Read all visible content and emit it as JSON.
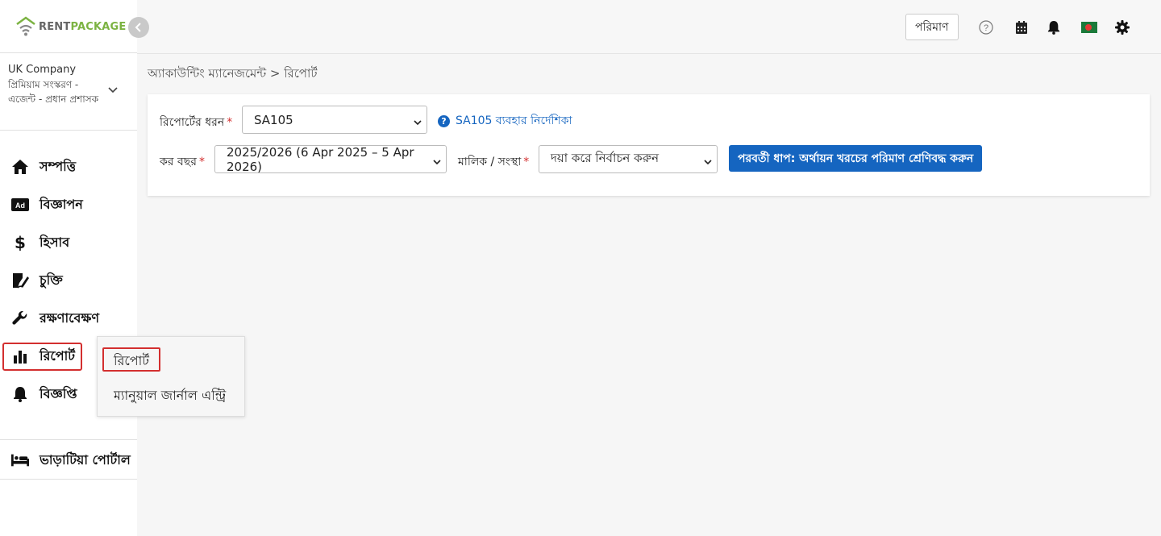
{
  "brand": {
    "rent": "RENT",
    "package": "PACKAGE",
    "accent": "#7cb342"
  },
  "company": {
    "name": "UK Company",
    "details": "প্রিমিয়াম সংস্করণ - এজেন্ট - প্রধান প্রশাসক"
  },
  "sidebar": {
    "items": [
      {
        "label": "সম্পত্তি",
        "icon": "home-icon"
      },
      {
        "label": "বিজ্ঞাপন",
        "icon": "ad-icon"
      },
      {
        "label": "হিসাব",
        "icon": "dollar-icon"
      },
      {
        "label": "চুক্তি",
        "icon": "contract-icon"
      },
      {
        "label": "রক্ষণাবেক্ষণ",
        "icon": "wrench-icon"
      },
      {
        "label": "রিপোর্ট",
        "icon": "bar-chart-icon"
      },
      {
        "label": "বিজ্ঞপ্তি",
        "icon": "bell-icon"
      }
    ],
    "tenant_portal": {
      "label": "ভাড়াটিয়া পোর্টাল",
      "icon": "bed-icon"
    }
  },
  "topbar": {
    "amount_label": "পরিমাণ",
    "icons": [
      "help-icon",
      "calendar-icon",
      "bell-icon",
      "flag-icon",
      "gear-icon"
    ]
  },
  "breadcrumb": "অ্যাকাউন্টিং ম্যানেজমেন্ট > রিপোর্ট",
  "form": {
    "report_type": {
      "label": "রিপোর্টের ধরন",
      "required": "*",
      "value": "SA105"
    },
    "help_link": "SA105 ব্যবহার নির্দেশিকা",
    "tax_year": {
      "label": "কর বছর",
      "required": "*",
      "value": "2025/2026 (6 Apr 2025 – 5 Apr 2026)"
    },
    "owner": {
      "label": "মালিক / সংস্থা",
      "required": "*",
      "value": "দয়া করে নির্বাচন করুন"
    },
    "next_button": "পরবর্তী ধাপ: অর্থায়ন খরচের পরিমাণ শ্রেণিবদ্ধ করুন"
  },
  "popup": {
    "items": [
      "রিপোর্ট",
      "ম্যানুয়াল জার্নাল এন্ট্রি"
    ]
  },
  "colors": {
    "primary": "#1565c0",
    "highlight": "#d32f2f"
  }
}
